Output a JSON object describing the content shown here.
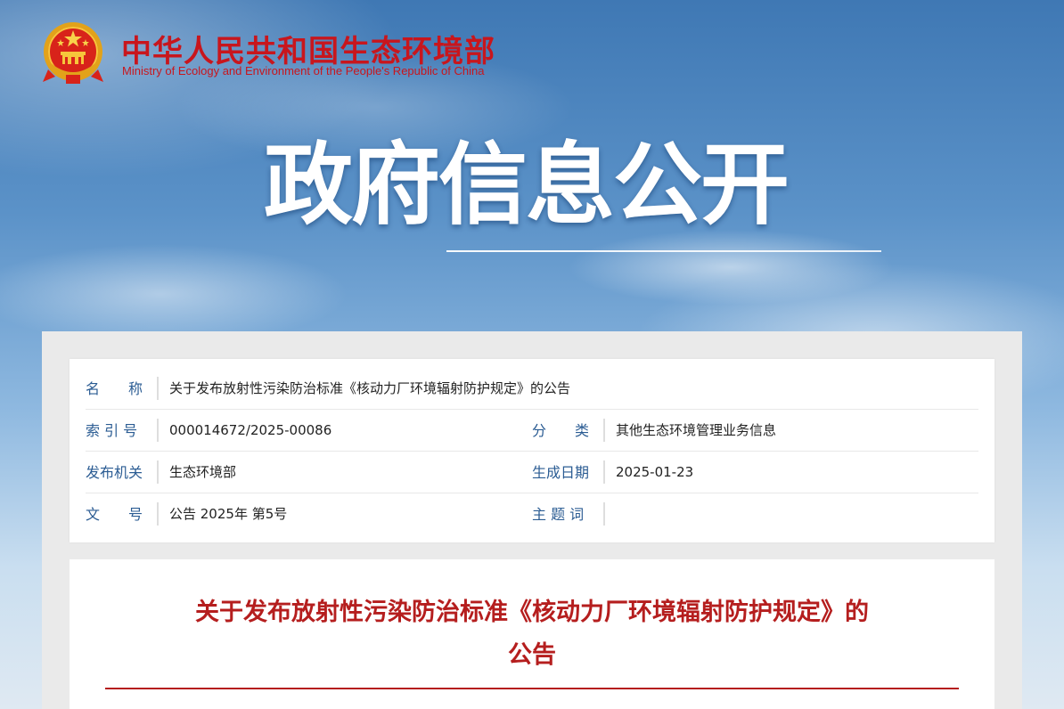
{
  "header": {
    "ministry_cn": "中华人民共和国生态环境部",
    "ministry_en": "Ministry of Ecology and Environment of the People's Republic of China",
    "section_title": "政府信息公开"
  },
  "meta": {
    "name_label": "名　　称",
    "name_value": "关于发布放射性污染防治标准《核动力厂环境辐射防护规定》的公告",
    "index_label": "索 引 号",
    "index_value": "000014672/2025-00086",
    "category_label": "分　　类",
    "category_value": "其他生态环境管理业务信息",
    "publisher_label": "发布机关",
    "publisher_value": "生态环境部",
    "date_label": "生成日期",
    "date_value": "2025-01-23",
    "docno_label": "文　　号",
    "docno_value": "公告 2025年 第5号",
    "keywords_label": "主 题 词",
    "keywords_value": ""
  },
  "document": {
    "title_line1": "关于发布放射性污染防治标准《核动力厂环境辐射防护规定》的",
    "title_line2": "公告"
  },
  "colors": {
    "brand_red": "#c8161d",
    "label_blue": "#2b5c93",
    "title_red": "#b51e1e"
  }
}
